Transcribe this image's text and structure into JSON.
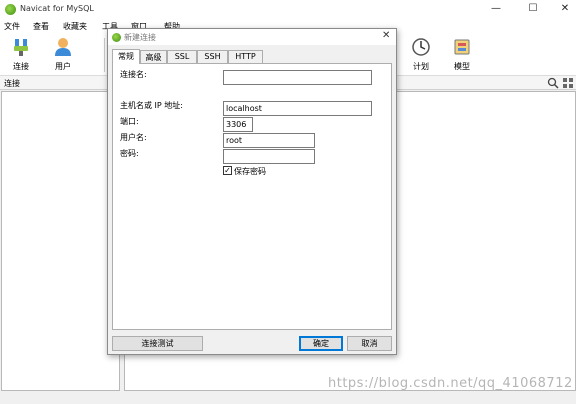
{
  "app": {
    "title": "Navicat for MySQL",
    "window_controls": {
      "minimize": "—",
      "maximize": "☐",
      "close": "✕"
    }
  },
  "menu": [
    "文件",
    "查看",
    "收藏夹",
    "工具",
    "窗口",
    "帮助"
  ],
  "toolbar": {
    "connect": "连接",
    "user": "用户",
    "schedule": "计划",
    "model": "模型"
  },
  "connections_header": "连接",
  "watermark": "https://blog.csdn.net/qq_41068712",
  "dialog": {
    "title": "新建连接",
    "close": "✕",
    "tabs": [
      "常规",
      "高级",
      "SSL",
      "SSH",
      "HTTP"
    ],
    "fields": {
      "connection_name": {
        "label": "连接名:",
        "value": ""
      },
      "host": {
        "label": "主机名或 IP 地址:",
        "value": "localhost"
      },
      "port": {
        "label": "端口:",
        "value": "3306"
      },
      "username": {
        "label": "用户名:",
        "value": "root"
      },
      "password": {
        "label": "密码:",
        "value": ""
      }
    },
    "save_password": {
      "label": "保存密码",
      "checked": true,
      "mark": "✓"
    },
    "buttons": {
      "test": "连接测试",
      "ok": "确定",
      "cancel": "取消"
    }
  },
  "icons": [
    "connect-icon",
    "user-icon",
    "schedule-icon",
    "model-icon",
    "search-icon",
    "grid-icon"
  ]
}
